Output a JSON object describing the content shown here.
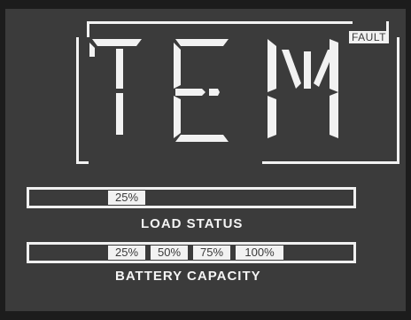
{
  "display": {
    "characters": [
      "T",
      "E",
      "M"
    ],
    "fault_label": "FAULT"
  },
  "load": {
    "caption": "LOAD STATUS",
    "segments": [
      "25%"
    ]
  },
  "battery": {
    "caption": "BATTERY CAPACITY",
    "segments": [
      "25%",
      "50%",
      "75%",
      "100%"
    ]
  },
  "colors": {
    "background": "#3b3b3b",
    "segment_on": "#f2f2f2"
  }
}
